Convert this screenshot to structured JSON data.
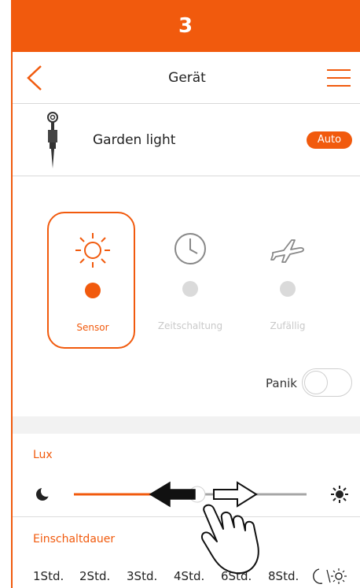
{
  "step": {
    "number": "3",
    "color": "#f15a0d"
  },
  "header": {
    "title": "Gerät",
    "back_icon": "chevron-left-icon",
    "menu_icon": "hamburger-menu-icon"
  },
  "device": {
    "name": "Garden light",
    "mode_badge": "Auto",
    "icon": "garden-light-icon"
  },
  "modes": [
    {
      "label": "Sensor",
      "icon": "sun-icon",
      "active": true
    },
    {
      "label": "Zeitschaltung",
      "icon": "clock-icon",
      "active": false
    },
    {
      "label": "Zufällig",
      "icon": "airplane-icon",
      "active": false
    }
  ],
  "panic": {
    "label": "Panik",
    "enabled": false
  },
  "lux": {
    "label": "Lux",
    "min_icon": "moon-icon",
    "max_icon": "sun-icon",
    "level": 0.53
  },
  "duration": {
    "label": "Einschaltdauer",
    "options": [
      "1Std.",
      "2Std.",
      "3Std.",
      "4Std.",
      "6Std.",
      "8Std."
    ],
    "night_icon": "moon-sun-icon"
  },
  "colors": {
    "accent": "#f15a0d",
    "inactive": "#dadada",
    "track_inactive": "#a6a6a6"
  }
}
